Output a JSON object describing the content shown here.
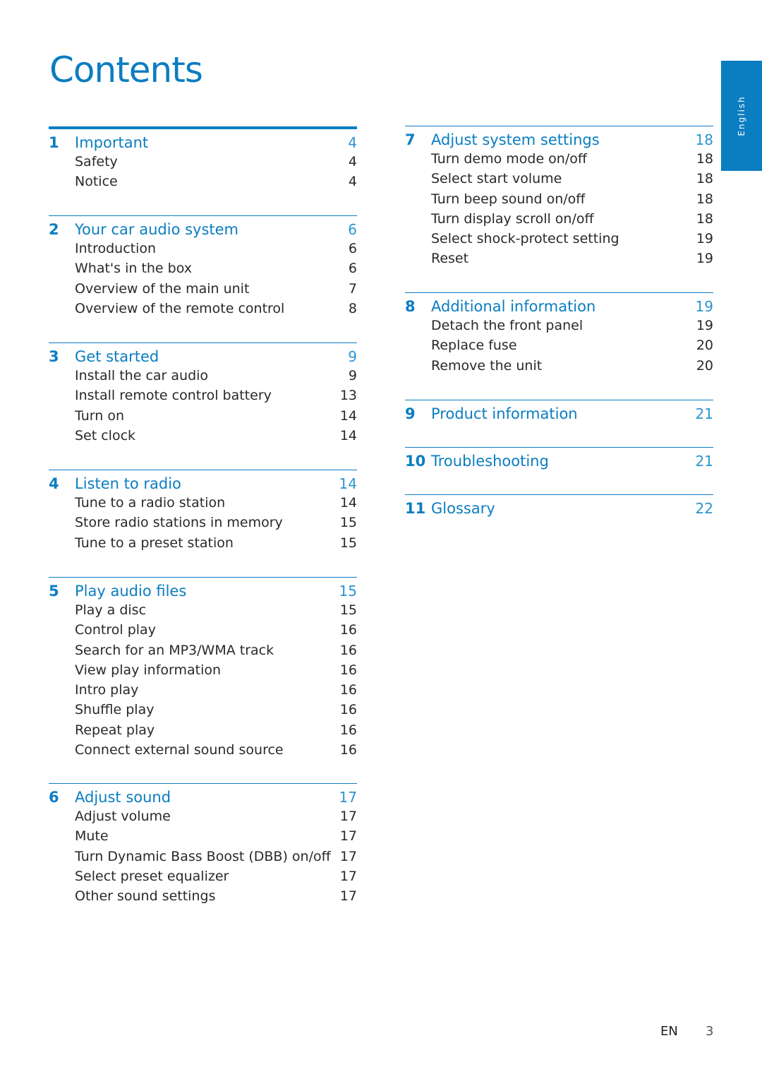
{
  "title": "Contents",
  "language_tab": "English",
  "colors": {
    "accent": "#0b7dc1",
    "text": "#231f20"
  },
  "sections": [
    {
      "num": "1",
      "title": "Important",
      "page": "4",
      "items": [
        {
          "label": "Safety",
          "page": "4"
        },
        {
          "label": "Notice",
          "page": "4"
        }
      ]
    },
    {
      "num": "2",
      "title": "Your car audio system",
      "page": "6",
      "items": [
        {
          "label": "Introduction",
          "page": "6"
        },
        {
          "label": "What's in the box",
          "page": "6"
        },
        {
          "label": "Overview of the main unit",
          "page": "7"
        },
        {
          "label": "Overview of the remote control",
          "page": "8"
        }
      ]
    },
    {
      "num": "3",
      "title": "Get started",
      "page": "9",
      "items": [
        {
          "label": "Install the car audio",
          "page": "9"
        },
        {
          "label": "Install remote control battery",
          "page": "13"
        },
        {
          "label": "Turn on",
          "page": "14"
        },
        {
          "label": "Set clock",
          "page": "14"
        }
      ]
    },
    {
      "num": "4",
      "title": "Listen to radio",
      "page": "14",
      "items": [
        {
          "label": "Tune to a radio station",
          "page": "14"
        },
        {
          "label": "Store radio stations in memory",
          "page": "15"
        },
        {
          "label": "Tune to a preset station",
          "page": "15"
        }
      ]
    },
    {
      "num": "5",
      "title": "Play audio files",
      "page": "15",
      "items": [
        {
          "label": "Play a disc",
          "page": "15"
        },
        {
          "label": "Control play",
          "page": "16"
        },
        {
          "label": "Search for an MP3/WMA track",
          "page": "16"
        },
        {
          "label": "View play information",
          "page": "16"
        },
        {
          "label": "Intro play",
          "page": "16"
        },
        {
          "label": "Shuffle play",
          "page": "16"
        },
        {
          "label": "Repeat play",
          "page": "16"
        },
        {
          "label": "Connect external sound source",
          "page": "16"
        }
      ]
    },
    {
      "num": "6",
      "title": "Adjust sound",
      "page": "17",
      "items": [
        {
          "label": "Adjust volume",
          "page": "17"
        },
        {
          "label": "Mute",
          "page": "17"
        },
        {
          "label": "Turn Dynamic Bass Boost (DBB) on/off",
          "page": "17"
        },
        {
          "label": "Select preset equalizer",
          "page": "17"
        },
        {
          "label": "Other sound settings",
          "page": "17"
        }
      ]
    },
    {
      "num": "7",
      "title": "Adjust system settings",
      "page": "18",
      "items": [
        {
          "label": "Turn demo mode on/off",
          "page": "18"
        },
        {
          "label": "Select start volume",
          "page": "18"
        },
        {
          "label": "Turn beep sound on/off",
          "page": "18"
        },
        {
          "label": "Turn display scroll on/off",
          "page": "18"
        },
        {
          "label": "Select shock-protect setting",
          "page": "19"
        },
        {
          "label": "Reset",
          "page": "19"
        }
      ]
    },
    {
      "num": "8",
      "title": "Additional information",
      "page": "19",
      "items": [
        {
          "label": "Detach the front panel",
          "page": "19"
        },
        {
          "label": "Replace fuse",
          "page": "20"
        },
        {
          "label": "Remove the unit",
          "page": "20"
        }
      ]
    },
    {
      "num": "9",
      "title": "Product information",
      "page": "21",
      "items": []
    },
    {
      "num": "10",
      "title": "Troubleshooting",
      "page": "21",
      "items": []
    },
    {
      "num": "11",
      "title": "Glossary",
      "page": "22",
      "items": []
    }
  ],
  "footer": {
    "lang": "EN",
    "page": "3"
  }
}
